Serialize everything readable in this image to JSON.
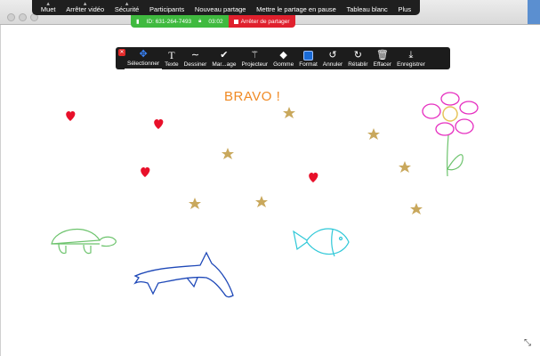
{
  "meeting_toolbar": {
    "items": [
      {
        "label": "Muet",
        "icon": "microphone-icon"
      },
      {
        "label": "Arrêter vidéo",
        "icon": "video-camera-icon"
      },
      {
        "label": "Sécurité",
        "icon": "shield-icon"
      },
      {
        "label": "Participants",
        "icon": "participants-icon"
      },
      {
        "label": "Nouveau partage",
        "icon": "share-screen-icon"
      },
      {
        "label": "Mettre le partage en pause",
        "icon": "pause-icon"
      },
      {
        "label": "Tableau blanc",
        "icon": "whiteboard-icon"
      },
      {
        "label": "Plus",
        "icon": "more-icon"
      }
    ]
  },
  "share_status": {
    "meeting_id": "ID: 631-264-7493",
    "timer": "03:02",
    "stop_label": "Arrêter de partager"
  },
  "annotation_toolbar": {
    "tools": [
      {
        "label": "Sélectionner",
        "icon": "move-arrows-icon",
        "active": true
      },
      {
        "label": "Texte",
        "icon": "text-T-icon",
        "active": false
      },
      {
        "label": "Dessiner",
        "icon": "squiggle-draw-icon",
        "active": false
      },
      {
        "label": "Mar...age",
        "icon": "checkmark-stamp-icon",
        "active": false
      },
      {
        "label": "Projecteur",
        "icon": "spotlight-wand-icon",
        "active": false
      },
      {
        "label": "Gomme",
        "icon": "eraser-icon",
        "active": false
      },
      {
        "label": "Format",
        "icon": "color-swatch-icon",
        "active": false
      },
      {
        "label": "Annuler",
        "icon": "undo-icon",
        "active": false
      },
      {
        "label": "Rétablir",
        "icon": "redo-icon",
        "active": false
      },
      {
        "label": "Effacer",
        "icon": "trash-icon",
        "active": false
      },
      {
        "label": "Enregistrer",
        "icon": "save-download-icon",
        "active": false
      }
    ]
  },
  "whiteboard": {
    "text": "BRAVO !"
  },
  "colors": {
    "bravo": "#f08a24",
    "heart": "#e8102a",
    "star": "#c9a85c",
    "turtle": "#6cc36c",
    "dolphin": "#1f49b8",
    "fish": "#2fc8d8",
    "flower": "#e62fc0",
    "flower_center": "#e6c45a",
    "stem": "#6cc36c",
    "share_green": "#3fba3f",
    "share_red": "#e0202d"
  }
}
